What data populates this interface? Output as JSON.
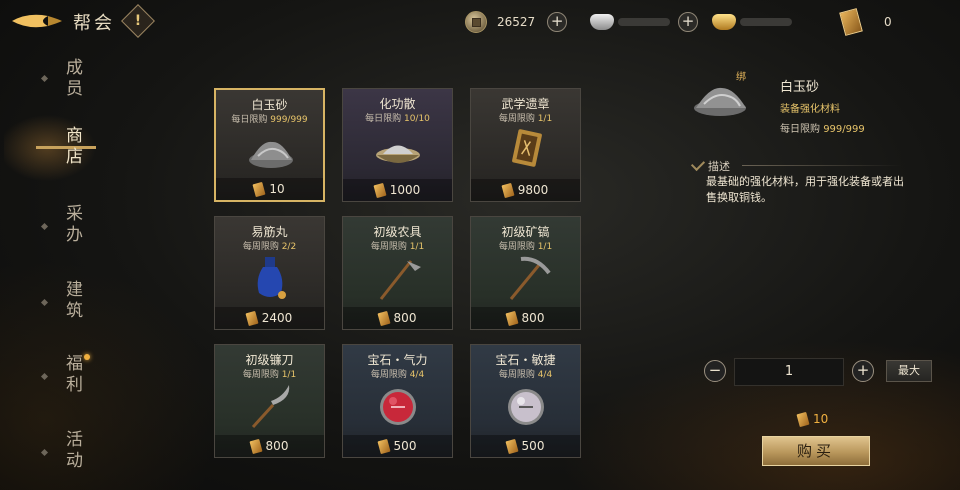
{
  "header": {
    "title": "帮会",
    "alert_symbol": "!",
    "copper_value": "26527",
    "token_value": "0"
  },
  "nav": {
    "items": [
      {
        "label": "成员",
        "active": false,
        "notify": false
      },
      {
        "label": "商店",
        "active": true,
        "notify": false
      },
      {
        "label": "采办",
        "active": false,
        "notify": false
      },
      {
        "label": "建筑",
        "active": false,
        "notify": false
      },
      {
        "label": "福利",
        "active": false,
        "notify": true
      },
      {
        "label": "活动",
        "active": false,
        "notify": false
      }
    ]
  },
  "shop": {
    "items": [
      {
        "name": "白玉砂",
        "limit_label": "每日限购",
        "limit": "999/999",
        "price": "10",
        "icon": "white-jade-sand-icon"
      },
      {
        "name": "化功散",
        "limit_label": "每日限购",
        "limit": "10/10",
        "price": "1000",
        "icon": "powder-bowl-icon"
      },
      {
        "name": "武学遗章",
        "limit_label": "每周限购",
        "limit": "1/1",
        "price": "9800",
        "icon": "martial-scroll-icon"
      },
      {
        "name": "易筋丸",
        "limit_label": "每周限购",
        "limit": "2/2",
        "price": "2400",
        "icon": "blue-vase-icon"
      },
      {
        "name": "初级农具",
        "limit_label": "每周限购",
        "limit": "1/1",
        "price": "800",
        "icon": "hoe-icon"
      },
      {
        "name": "初级矿镐",
        "limit_label": "每周限购",
        "limit": "1/1",
        "price": "800",
        "icon": "pickaxe-icon"
      },
      {
        "name": "初级镰刀",
        "limit_label": "每周限购",
        "limit": "1/1",
        "price": "800",
        "icon": "sickle-icon"
      },
      {
        "name": "宝石・气力",
        "limit_label": "每周限购",
        "limit": "4/4",
        "price": "500",
        "icon": "red-gem-icon"
      },
      {
        "name": "宝石・敏捷",
        "limit_label": "每周限购",
        "limit": "4/4",
        "price": "500",
        "icon": "silver-gem-icon"
      }
    ]
  },
  "detail": {
    "bind": "绑",
    "name": "白玉砂",
    "type": "装备强化材料",
    "limit_label": "每日限购",
    "limit": "999/999",
    "desc_title": "描述",
    "desc_text": "最基础的强化材料，用于强化装备或者出售换取铜钱。",
    "quantity": "1",
    "minus": "−",
    "plus": "+",
    "max_label": "最大",
    "total": "10",
    "buy_label": "购买"
  },
  "colors": {
    "accent_gold": "#d7b464",
    "price_orange": "#f0b040"
  }
}
